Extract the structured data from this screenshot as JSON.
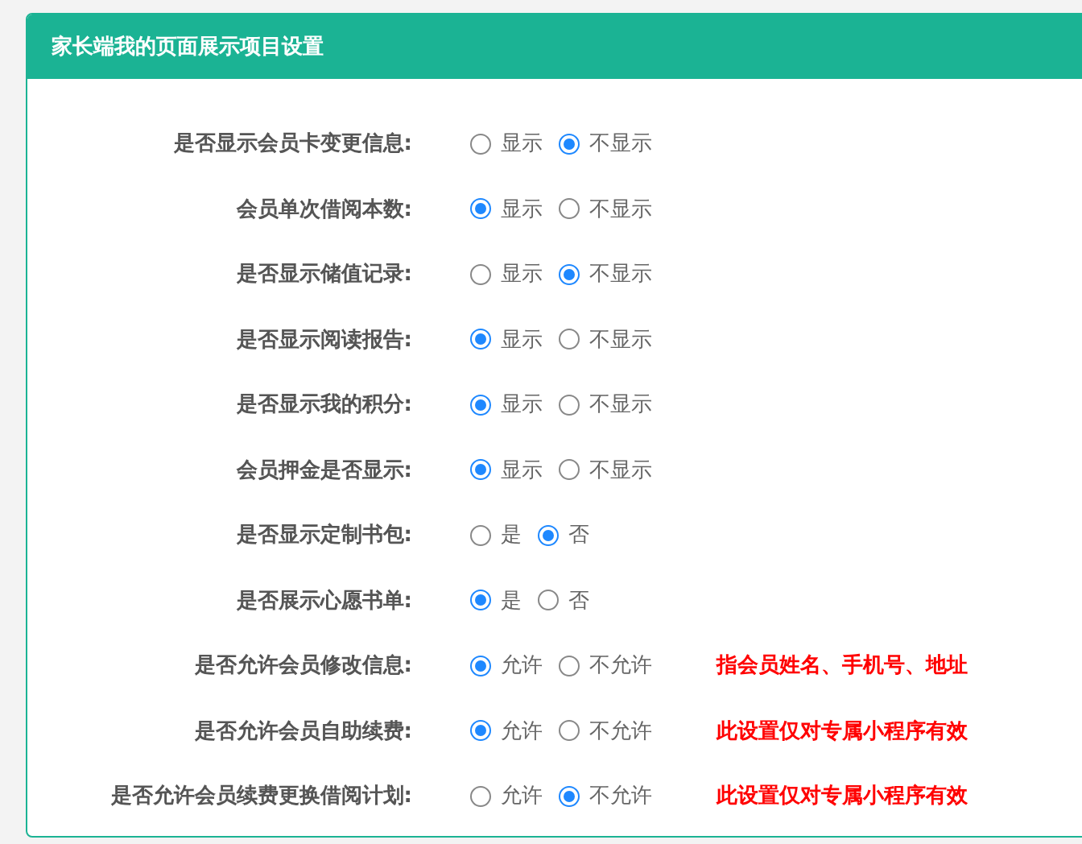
{
  "panel": {
    "title": "家长端我的页面展示项目设置"
  },
  "settings": [
    {
      "label": "是否显示会员卡变更信息:",
      "options": [
        {
          "label": "显示",
          "selected": false
        },
        {
          "label": "不显示",
          "selected": true
        }
      ]
    },
    {
      "label": "会员单次借阅本数:",
      "options": [
        {
          "label": "显示",
          "selected": true
        },
        {
          "label": "不显示",
          "selected": false
        }
      ]
    },
    {
      "label": "是否显示储值记录:",
      "options": [
        {
          "label": "显示",
          "selected": false
        },
        {
          "label": "不显示",
          "selected": true
        }
      ]
    },
    {
      "label": "是否显示阅读报告:",
      "options": [
        {
          "label": "显示",
          "selected": true
        },
        {
          "label": "不显示",
          "selected": false
        }
      ]
    },
    {
      "label": "是否显示我的积分:",
      "options": [
        {
          "label": "显示",
          "selected": true
        },
        {
          "label": "不显示",
          "selected": false
        }
      ]
    },
    {
      "label": "会员押金是否显示:",
      "options": [
        {
          "label": "显示",
          "selected": true
        },
        {
          "label": "不显示",
          "selected": false
        }
      ]
    },
    {
      "label": "是否显示定制书包:",
      "options": [
        {
          "label": "是",
          "selected": false
        },
        {
          "label": "否",
          "selected": true
        }
      ]
    },
    {
      "label": "是否展示心愿书单:",
      "options": [
        {
          "label": "是",
          "selected": true
        },
        {
          "label": "否",
          "selected": false
        }
      ]
    },
    {
      "label": "是否允许会员修改信息:",
      "options": [
        {
          "label": "允许",
          "selected": true
        },
        {
          "label": "不允许",
          "selected": false
        }
      ],
      "note": "指会员姓名、手机号、地址"
    },
    {
      "label": "是否允许会员自助续费:",
      "options": [
        {
          "label": "允许",
          "selected": true
        },
        {
          "label": "不允许",
          "selected": false
        }
      ],
      "note": "此设置仅对专属小程序有效"
    },
    {
      "label": "是否允许会员续费更换借阅计划:",
      "options": [
        {
          "label": "允许",
          "selected": false
        },
        {
          "label": "不允许",
          "selected": true
        }
      ],
      "note": "此设置仅对专属小程序有效"
    }
  ]
}
